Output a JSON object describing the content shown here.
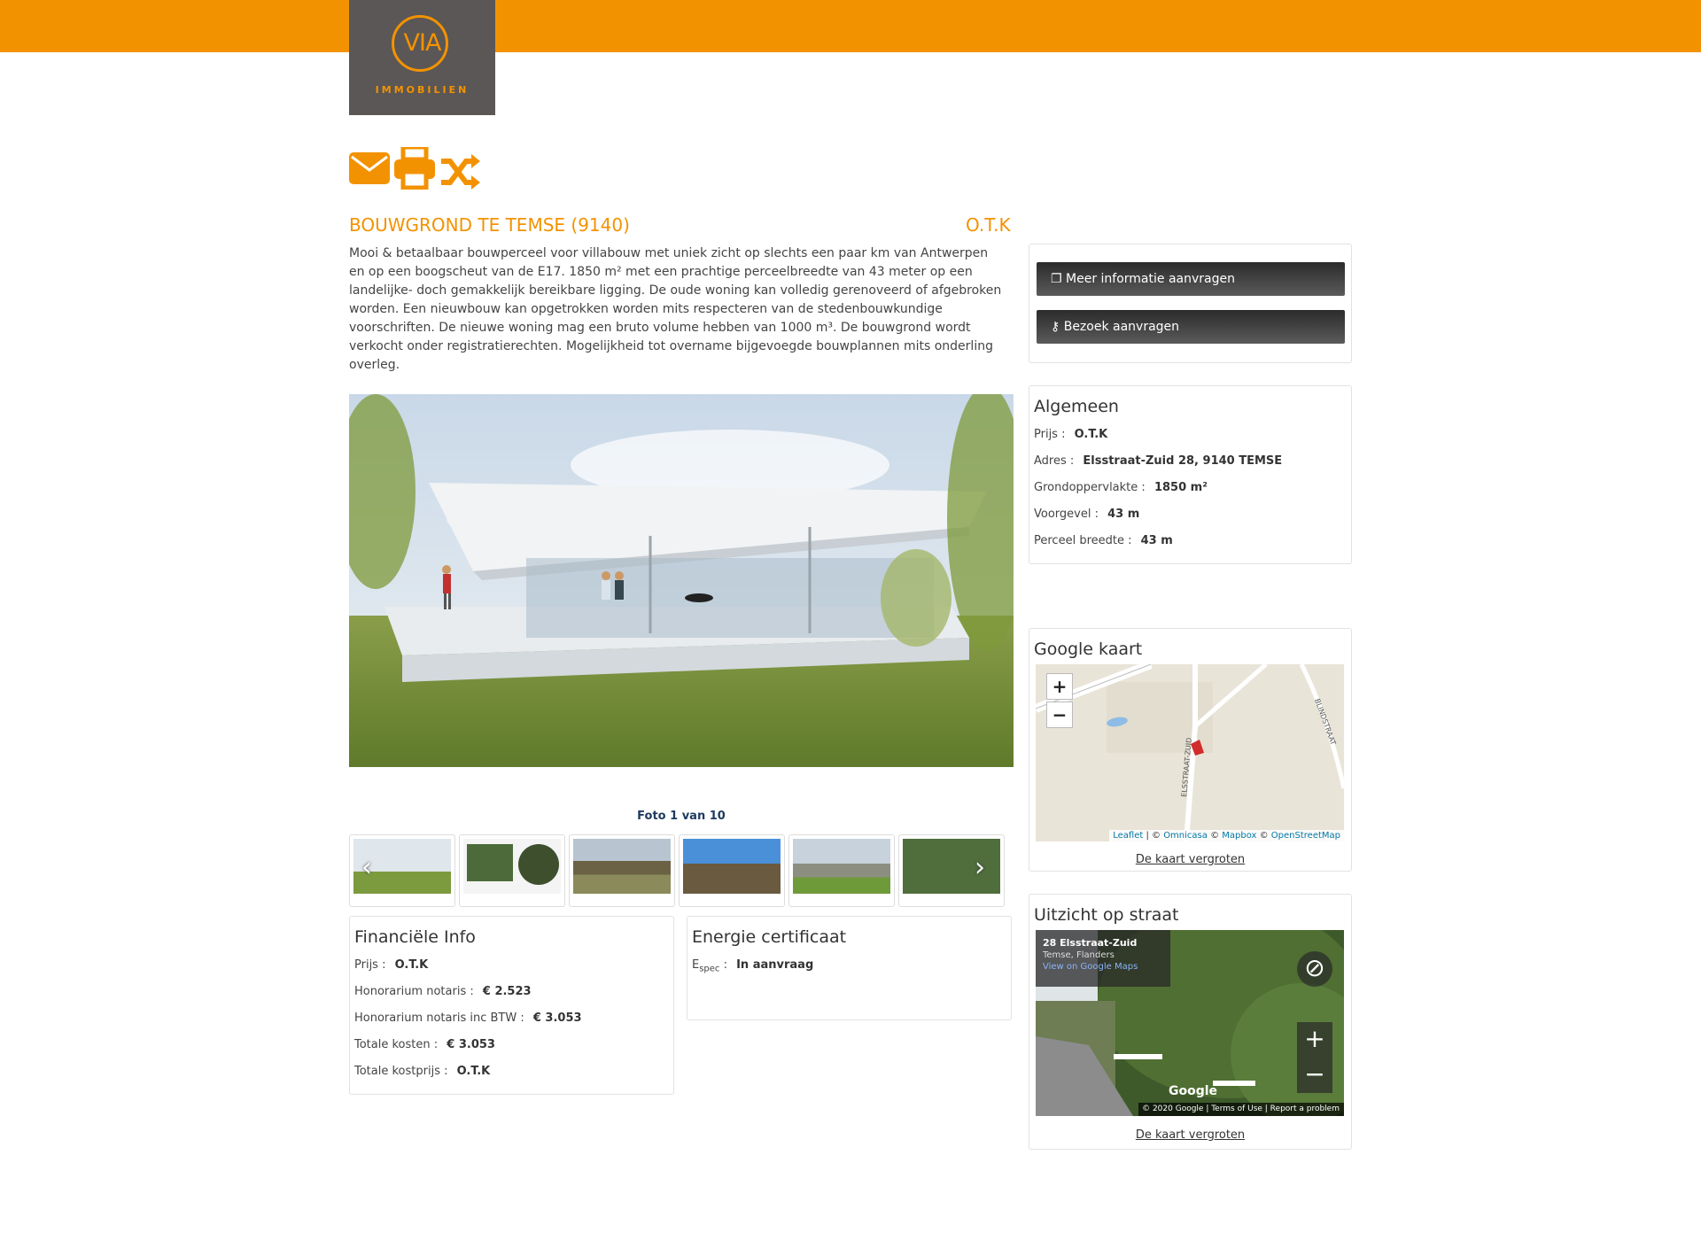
{
  "brand": {
    "logo_text": "VIA",
    "logo_sub": "IMMOBILIEN",
    "accent": "#f39200",
    "dark": "#5a5756"
  },
  "toolbar": {
    "icons": [
      "envelope-icon",
      "print-icon",
      "shuffle-icon"
    ]
  },
  "listing": {
    "title": "BOUWGROND TE TEMSE (9140)",
    "price": "O.T.K",
    "description": "Mooi & betaalbaar bouwperceel voor villabouw met uniek zicht op slechts een paar km van Antwerpen en op een boogscheut van de E17. 1850 m² met een prachtige perceelbreedte van 43 meter op een landelijke- doch gemakkelijk bereikbare ligging. De oude woning kan volledig gerenoveerd of afgebroken worden. Een nieuwbouw kan opgetrokken worden mits respecteren van de stedenbouwkundige voorschriften. De nieuwe woning mag een bruto volume hebben van 1000 m³. De bouwgrond wordt verkocht onder registratierechten. Mogelijkheid tot overname bijgevoegde bouwplannen mits onderling overleg."
  },
  "gallery": {
    "counter": "Foto 1 van 10",
    "thumbnail_count": 6
  },
  "actions": {
    "info_label": "Meer informatie aanvragen",
    "visit_label": "Bezoek aanvragen"
  },
  "general": {
    "heading": "Algemeen",
    "rows": [
      {
        "label": "Prijs",
        "value": "O.T.K"
      },
      {
        "label": "Adres",
        "value": "Elsstraat-Zuid 28, 9140 TEMSE"
      },
      {
        "label": "Grondoppervlakte",
        "value": "1850 m²"
      },
      {
        "label": "Voorgevel",
        "value": "43 m"
      },
      {
        "label": "Perceel breedte",
        "value": "43 m"
      }
    ]
  },
  "map": {
    "heading": "Google kaart",
    "zoom_in": "+",
    "zoom_out": "−",
    "street_label_1": "ELSSTRAAT-ZUID",
    "street_label_2": "BLINDSTRAAT",
    "attribution": {
      "leaflet": "Leaflet",
      "sep1": " | © ",
      "omnicasa": "Omnicasa",
      "sep2": " © ",
      "mapbox": "Mapbox",
      "sep3": " © ",
      "osm": "OpenStreetMap"
    },
    "enlarge": "De kaart vergroten"
  },
  "streetview": {
    "heading": "Uitzicht op straat",
    "address": "28 Elsstraat-Zuid",
    "city": "Temse, Flanders",
    "link": "View on Google Maps",
    "google": "Google",
    "footer": "© 2020 Google   |   Terms of Use   |   Report a problem",
    "enlarge": "De kaart vergroten"
  },
  "finance": {
    "heading": "Financiële Info",
    "rows": [
      {
        "label": "Prijs",
        "value": "O.T.K"
      },
      {
        "label": "Honorarium notaris",
        "value": "€ 2.523"
      },
      {
        "label": "Honorarium notaris inc BTW",
        "value": "€ 3.053"
      },
      {
        "label": "Totale kosten",
        "value": "€ 3.053"
      },
      {
        "label": "Totale kostprijs",
        "value": "O.T.K"
      }
    ]
  },
  "energy": {
    "heading": "Energie certificaat",
    "label_main": "E",
    "label_sub": "spec",
    "value": "In aanvraag"
  }
}
